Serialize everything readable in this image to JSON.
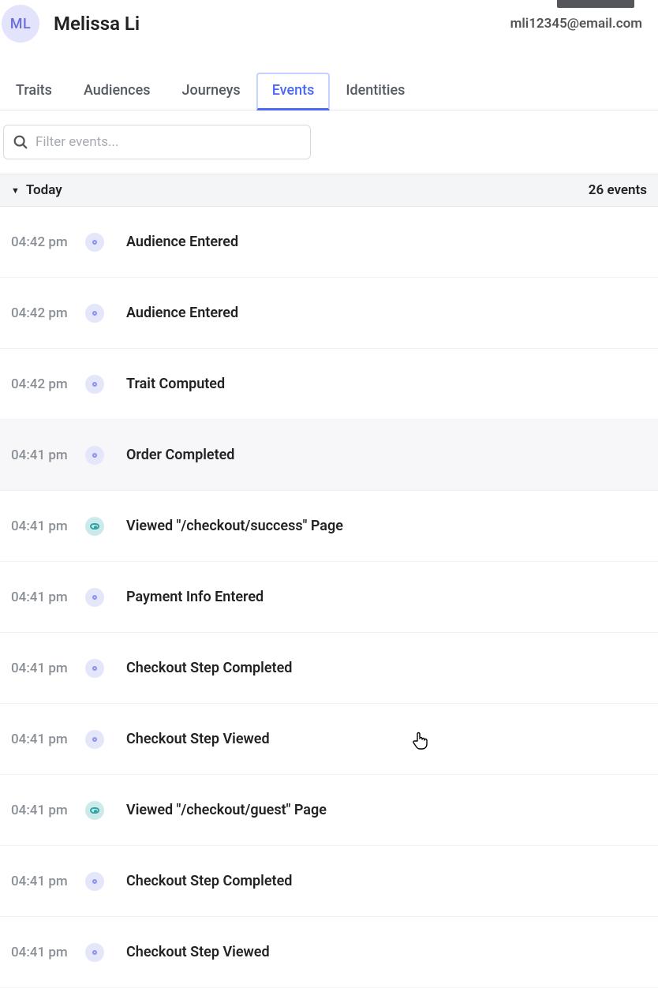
{
  "profile": {
    "initials": "ML",
    "name": "Melissa Li",
    "email": "mli12345@email.com"
  },
  "tabs": [
    {
      "label": "Traits",
      "active": false
    },
    {
      "label": "Audiences",
      "active": false
    },
    {
      "label": "Journeys",
      "active": false
    },
    {
      "label": "Events",
      "active": true
    },
    {
      "label": "Identities",
      "active": false
    }
  ],
  "filter": {
    "placeholder": "Filter events..."
  },
  "day": {
    "label": "Today",
    "count": "26 events"
  },
  "events": [
    {
      "time": "04:42 pm",
      "name": "Audience Entered",
      "icon": "purple",
      "selected": false
    },
    {
      "time": "04:42 pm",
      "name": "Audience Entered",
      "icon": "purple",
      "selected": false
    },
    {
      "time": "04:42 pm",
      "name": "Trait Computed",
      "icon": "purple",
      "selected": false
    },
    {
      "time": "04:41 pm",
      "name": "Order Completed",
      "icon": "purple",
      "selected": true
    },
    {
      "time": "04:41 pm",
      "name": "Viewed \"/checkout/success\" Page",
      "icon": "teal",
      "selected": false
    },
    {
      "time": "04:41 pm",
      "name": "Payment Info Entered",
      "icon": "purple",
      "selected": false
    },
    {
      "time": "04:41 pm",
      "name": "Checkout Step Completed",
      "icon": "purple",
      "selected": false
    },
    {
      "time": "04:41 pm",
      "name": "Checkout Step Viewed",
      "icon": "purple",
      "selected": false
    },
    {
      "time": "04:41 pm",
      "name": "Viewed \"/checkout/guest\" Page",
      "icon": "teal",
      "selected": false
    },
    {
      "time": "04:41 pm",
      "name": "Checkout Step Completed",
      "icon": "purple",
      "selected": false
    },
    {
      "time": "04:41 pm",
      "name": "Checkout Step Viewed",
      "icon": "purple",
      "selected": false
    }
  ]
}
